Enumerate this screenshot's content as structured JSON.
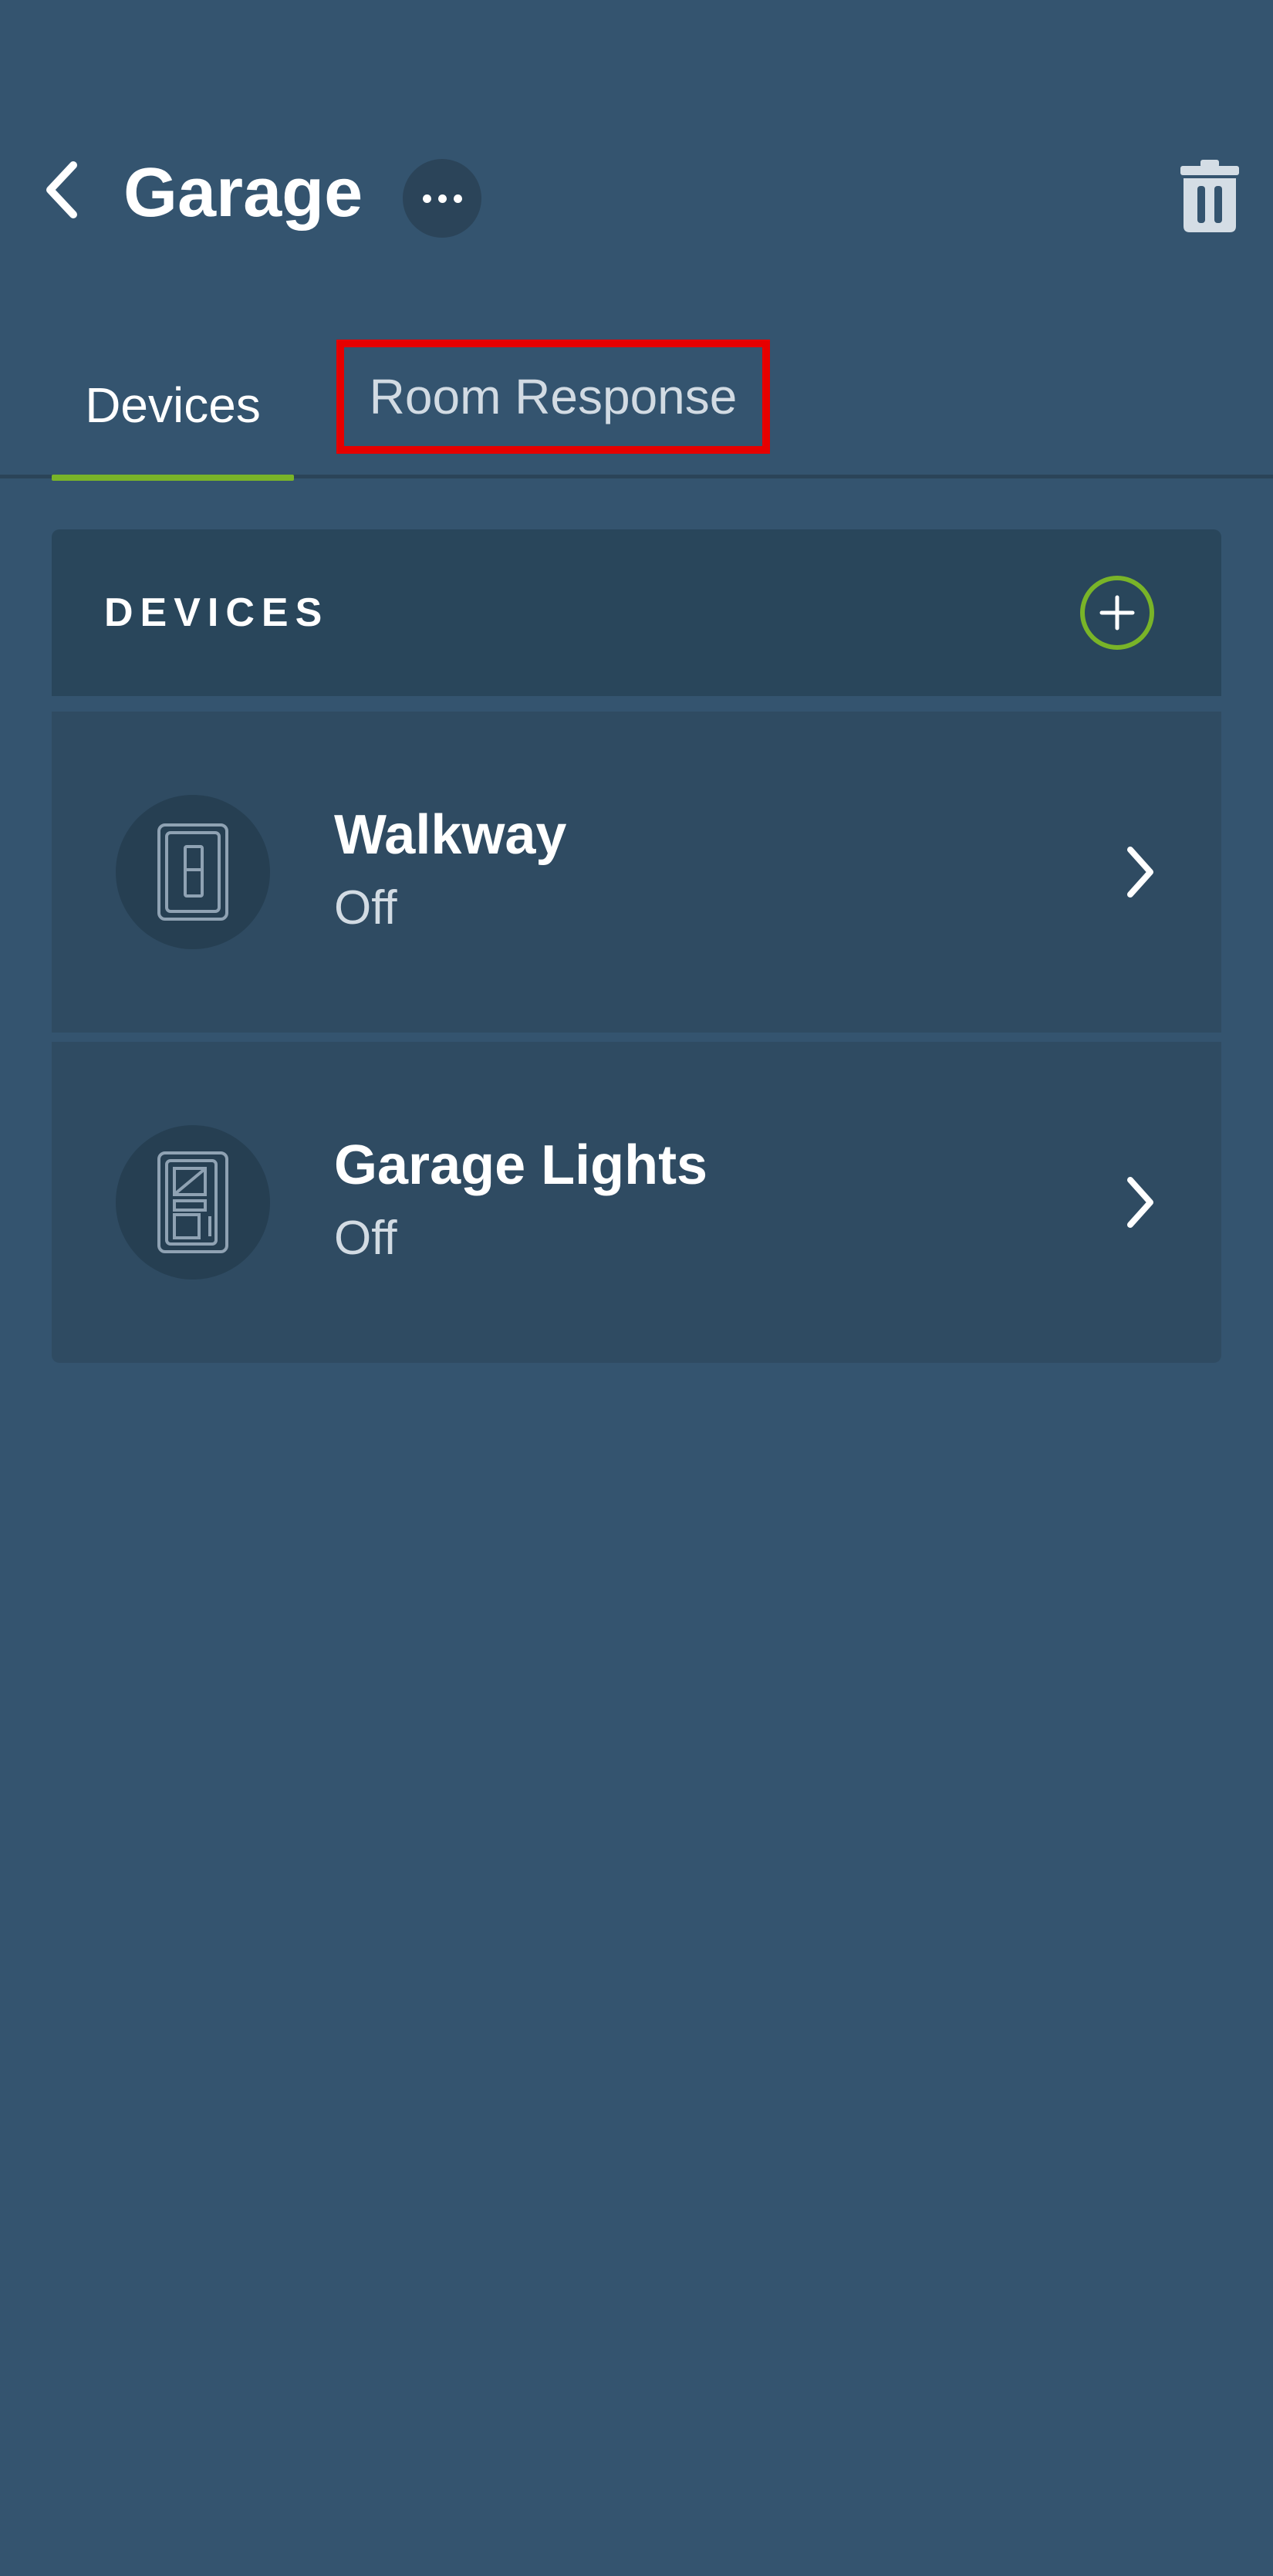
{
  "header": {
    "back_icon": "chevron-left-icon",
    "title": "Garage",
    "more_icon": "more-horizontal-icon",
    "trash_icon": "trash-icon"
  },
  "tabs": [
    {
      "label": "Devices",
      "active": true
    },
    {
      "label": "Room Response",
      "active": false,
      "highlighted": true
    }
  ],
  "devices_section": {
    "label": "DEVICES",
    "add_icon": "add-circle-icon"
  },
  "devices": [
    {
      "name": "Walkway",
      "status": "Off",
      "icon": "light-switch-icon"
    },
    {
      "name": "Garage Lights",
      "status": "Off",
      "icon": "dimmer-switch-icon"
    }
  ],
  "colors": {
    "background": "#34546f",
    "accent": "#79b428",
    "highlight": "#e60000",
    "card": "#2f4b62",
    "section_header": "#29465b"
  }
}
